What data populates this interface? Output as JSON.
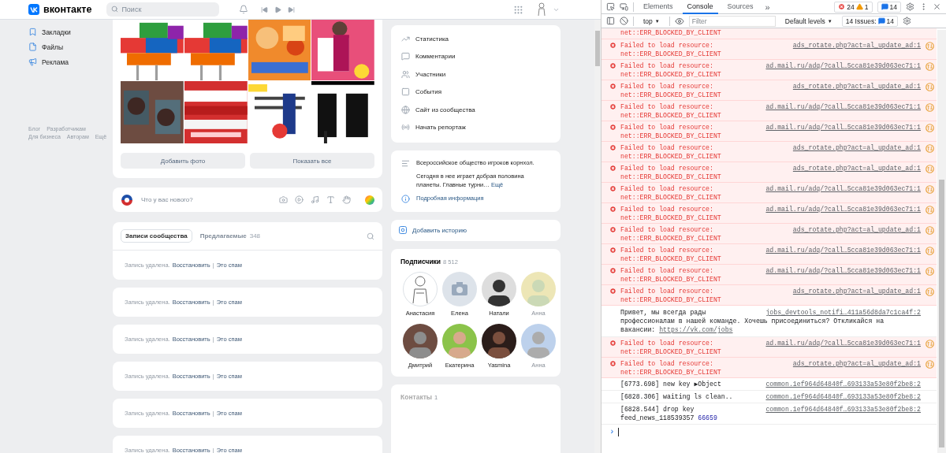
{
  "vk": {
    "header": {
      "logo": "вконтакте",
      "search_placeholder": "Поиск"
    },
    "left_nav": [
      {
        "label": "Закладки",
        "kind": "bookmark"
      },
      {
        "label": "Файлы",
        "kind": "file"
      },
      {
        "label": "Реклама",
        "kind": "ads"
      }
    ],
    "footer_links": [
      "Блог",
      "Разработчикам",
      "Для бизнеса",
      "Авторам",
      "Ещё"
    ],
    "photos": [
      {
        "kind": "picture"
      },
      {
        "kind": "picture"
      },
      {
        "kind": "picture"
      },
      {
        "kind": "picture"
      },
      {
        "kind": "picture"
      },
      {
        "kind": "picture"
      },
      {
        "kind": "picture"
      },
      {
        "kind": "picture"
      }
    ],
    "photo_buttons": [
      "Добавить фото",
      "Показать все"
    ],
    "composer": {
      "placeholder": "Что у вас нового?"
    },
    "feed_tabs": [
      {
        "label": "Записи сообщества",
        "selected": true
      },
      {
        "label": "Предлагаемые",
        "count": "348",
        "selected": false
      }
    ],
    "deleted_posts": [
      {
        "text": "Запись удалена.",
        "restore": "Восстановить",
        "separator": "|",
        "spam": "Это спам"
      },
      {
        "text": "Запись удалена.",
        "restore": "Восстановить",
        "separator": "|",
        "spam": "Это спам"
      },
      {
        "text": "Запись удалена.",
        "restore": "Восстановить",
        "separator": "|",
        "spam": "Это спам"
      },
      {
        "text": "Запись удалена.",
        "restore": "Восстановить",
        "separator": "|",
        "spam": "Это спам"
      },
      {
        "text": "Запись удалена.",
        "restore": "Восстановить",
        "separator": "|",
        "spam": "Это спам"
      },
      {
        "text": "Запись удалена.",
        "restore": "Восстановить",
        "separator": "|",
        "spam": "Это спам"
      }
    ],
    "community_menu": [
      {
        "label": "Статистика",
        "kind": "stats"
      },
      {
        "label": "Комментарии",
        "kind": "comments"
      },
      {
        "label": "Участники",
        "kind": "members"
      },
      {
        "label": "События",
        "kind": "events"
      },
      {
        "label": "Сайт из сообщества",
        "kind": "site"
      },
      {
        "label": "Начать репортаж",
        "kind": "live"
      }
    ],
    "about": {
      "title": "Всероссийское общество игроков корнхол.",
      "text": "Сегодня в нее играет добрая половина планеты. Главные турни…",
      "more_link": "Ещё",
      "info_link": "Подробная информация"
    },
    "add_story": "Добавить историю",
    "subscribers": {
      "title": "Подписчики",
      "count": "8 512",
      "people": [
        {
          "name": "Анастасия",
          "kind": "sketch",
          "faded": false
        },
        {
          "name": "Елена",
          "kind": "camera",
          "faded": false
        },
        {
          "name": "Натали",
          "kind": "picture",
          "faded": false
        },
        {
          "name": "Анна",
          "kind": "picture",
          "faded": true
        },
        {
          "name": "Дмитрий",
          "kind": "picture",
          "faded": false
        },
        {
          "name": "Екатерина",
          "kind": "picture",
          "faded": false
        },
        {
          "name": "Yasmina",
          "kind": "picture",
          "faded": false
        },
        {
          "name": "Анна",
          "kind": "picture",
          "faded": true
        }
      ]
    },
    "contacts": {
      "title": "Контакты",
      "count": "1"
    }
  },
  "devtools": {
    "tabs": [
      {
        "label": "Elements",
        "selected": false
      },
      {
        "label": "Console",
        "selected": true
      },
      {
        "label": "Sources",
        "selected": false
      }
    ],
    "more_tabs": "»",
    "counts": {
      "errors": "24",
      "warnings": "1",
      "messages": "14"
    },
    "context": "top",
    "context_caret": "▼",
    "filter_placeholder": "Filter",
    "levels": "Default levels",
    "levels_caret": "▼",
    "issues_label": "14 Issues:",
    "issues_count": "14",
    "rows": [
      {
        "kind": "error-tail",
        "detail": "net::ERR_BLOCKED_BY_CLIENT"
      },
      {
        "kind": "error",
        "message": "Failed to load resource:",
        "detail": "net::ERR_BLOCKED_BY_CLIENT",
        "source": "ads_rotate.php?act=al_update_ad:1"
      },
      {
        "kind": "error",
        "message": "Failed to load resource:",
        "detail": "net::ERR_BLOCKED_BY_CLIENT",
        "source": "ad.mail.ru/adq/?call…5cca81e39d063ec71:1"
      },
      {
        "kind": "error",
        "message": "Failed to load resource:",
        "detail": "net::ERR_BLOCKED_BY_CLIENT",
        "source": "ads_rotate.php?act=al_update_ad:1"
      },
      {
        "kind": "error",
        "message": "Failed to load resource:",
        "detail": "net::ERR_BLOCKED_BY_CLIENT",
        "source": "ad.mail.ru/adq/?call…5cca81e39d063ec71:1"
      },
      {
        "kind": "error",
        "message": "Failed to load resource:",
        "detail": "net::ERR_BLOCKED_BY_CLIENT",
        "source": "ad.mail.ru/adq/?call…5cca81e39d063ec71:1"
      },
      {
        "kind": "error",
        "message": "Failed to load resource:",
        "detail": "net::ERR_BLOCKED_BY_CLIENT",
        "source": "ads_rotate.php?act=al_update_ad:1"
      },
      {
        "kind": "error",
        "message": "Failed to load resource:",
        "detail": "net::ERR_BLOCKED_BY_CLIENT",
        "source": "ads_rotate.php?act=al_update_ad:1"
      },
      {
        "kind": "error",
        "message": "Failed to load resource:",
        "detail": "net::ERR_BLOCKED_BY_CLIENT",
        "source": "ad.mail.ru/adq/?call…5cca81e39d063ec71:1"
      },
      {
        "kind": "error",
        "message": "Failed to load resource:",
        "detail": "net::ERR_BLOCKED_BY_CLIENT",
        "source": "ad.mail.ru/adq/?call…5cca81e39d063ec71:1"
      },
      {
        "kind": "error",
        "message": "Failed to load resource:",
        "detail": "net::ERR_BLOCKED_BY_CLIENT",
        "source": "ads_rotate.php?act=al_update_ad:1"
      },
      {
        "kind": "error",
        "message": "Failed to load resource:",
        "detail": "net::ERR_BLOCKED_BY_CLIENT",
        "source": "ad.mail.ru/adq/?call…5cca81e39d063ec71:1"
      },
      {
        "kind": "error",
        "message": "Failed to load resource:",
        "detail": "net::ERR_BLOCKED_BY_CLIENT",
        "source": "ad.mail.ru/adq/?call…5cca81e39d063ec71:1"
      },
      {
        "kind": "error",
        "message": "Failed to load resource:",
        "detail": "net::ERR_BLOCKED_BY_CLIENT",
        "source": "ads_rotate.php?act=al_update_ad:1"
      },
      {
        "kind": "info",
        "message": "Привет, мы всегда рады",
        "detail": "профессионалам в нашей команде. Хочешь присоединиться? Откликайся на вакансии:",
        "link": "https://vk.com/jobs",
        "source": "jobs_devtools_notifi…411a56d8da7c1ca4f:2"
      },
      {
        "kind": "error",
        "message": "Failed to load resource:",
        "detail": "net::ERR_BLOCKED_BY_CLIENT",
        "source": "ad.mail.ru/adq/?call…5cca81e39d063ec71:1"
      },
      {
        "kind": "error",
        "message": "Failed to load resource:",
        "detail": "net::ERR_BLOCKED_BY_CLIENT",
        "source": "ads_rotate.php?act=al_update_ad:1"
      },
      {
        "kind": "log",
        "time": "[6773.698]",
        "message": "new key",
        "object": "▶Object",
        "source": "common.1ef964d64840f…693133a53e80f2be8:2"
      },
      {
        "kind": "log",
        "time": "[6828.306]",
        "message": "waiting ls clean..",
        "source": "common.1ef964d64840f…693133a53e80f2be8:2"
      },
      {
        "kind": "log",
        "time": "[6828.544]",
        "message": "drop key",
        "detail": "feed_news_118539357",
        "number": "66659",
        "source": "common.1ef964d64840f…693133a53e80f2be8:2"
      }
    ],
    "prompt": "›"
  }
}
